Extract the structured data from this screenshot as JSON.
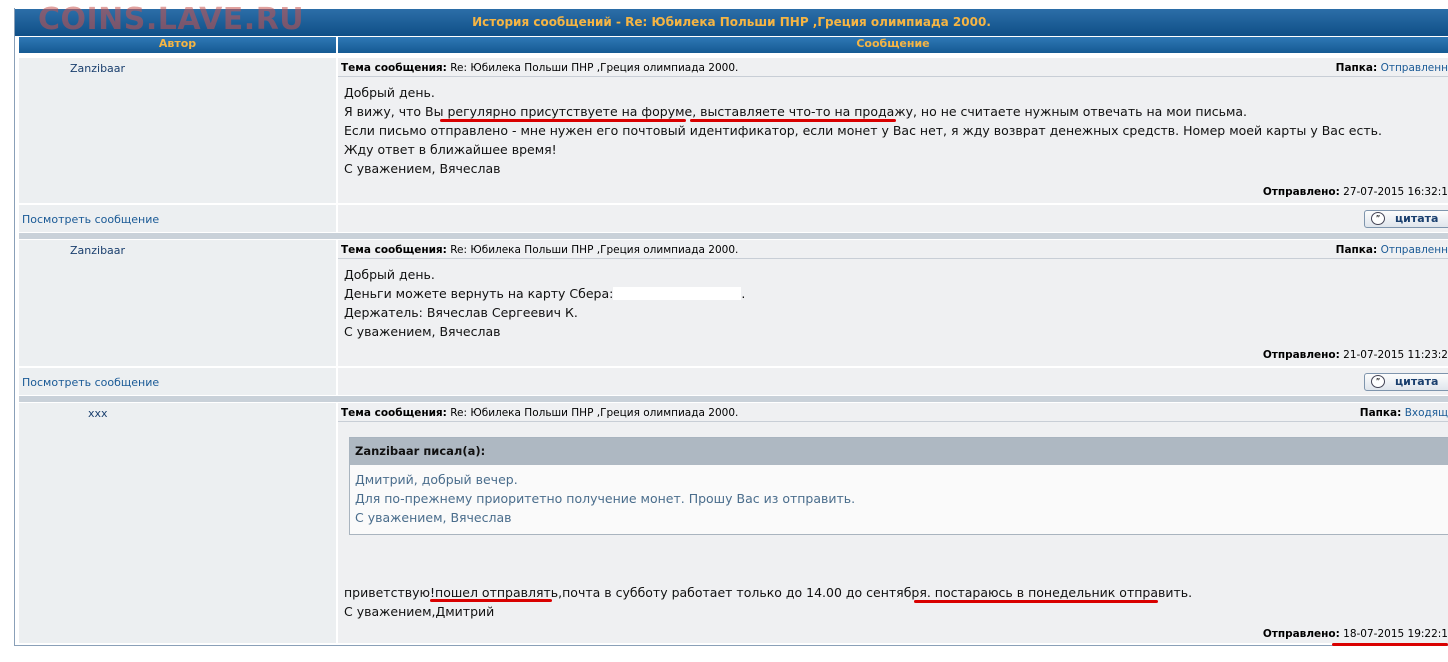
{
  "watermark": "COINS.LAVE.RU",
  "window_title": "История сообщений - Re: Юбилека Польши ПНР ,Греция олимпиада 2000.",
  "columns": {
    "author": "Автор",
    "message": "Сообщение"
  },
  "labels": {
    "subject": "Тема сообщения:",
    "folder": "Папка:",
    "sent": "Отправлено:",
    "view_message": "Посмотреть сообщение",
    "quote_button": "цитата"
  },
  "messages": [
    {
      "author": "Zanzibaar",
      "subject": "Re: Юбилека Польши ПНР ,Греция олимпиада 2000.",
      "folder": "Отправленн",
      "lines": [
        "Добрый день.",
        "Я вижу, что Вы регулярно присутствуете на форуме, выставляете что-то на продажу, но не считаете нужным отвечать на мои письма.",
        "Если письмо отправлено - мне нужен его почтовый идентификатор, если монет у Вас нет, я жду возврат денежных средств. Номер моей карты у Вас есть.",
        "Жду ответ в ближайшее время!",
        "С уважением, Вячеслав"
      ],
      "sent": "27-07-2015 16:32:1"
    },
    {
      "author": "Zanzibaar",
      "subject": "Re: Юбилека Польши ПНР ,Греция олимпиада 2000.",
      "folder": "Отправленн",
      "lines": [
        "Добрый день.",
        "Деньги можете вернуть на карту Сбера:",
        "Держатель: Вячеслав Сергеевич К.",
        "С уважением, Вячеслав"
      ],
      "line2_suffix": ".",
      "sent": "21-07-2015 11:23:2"
    },
    {
      "author": "xxx",
      "subject": "Re: Юбилека Польши ПНР ,Греция олимпиада 2000.",
      "folder": "Входящ",
      "quote": {
        "header": "Zanzibaar писал(а):",
        "lines": [
          "Дмитрий, добрый вечер.",
          "Для по-прежнему приоритетно получение монет. Прошу Вас из отправить.",
          "С уважением, Вячеслав"
        ]
      },
      "lines": [
        "приветствую!пошел отправлять,почта в субботу работает только до 14.00 до сентября. постараюсь в понедельник отправить.",
        "С уважением,Дмитрий"
      ],
      "sent": "18-07-2015 19:22:1"
    }
  ],
  "colors": {
    "title_bg": "#1a5a93",
    "title_text": "#f5b544",
    "cell_bg": "#eceff1",
    "link": "#1a5a96",
    "underline": "#d90000"
  }
}
